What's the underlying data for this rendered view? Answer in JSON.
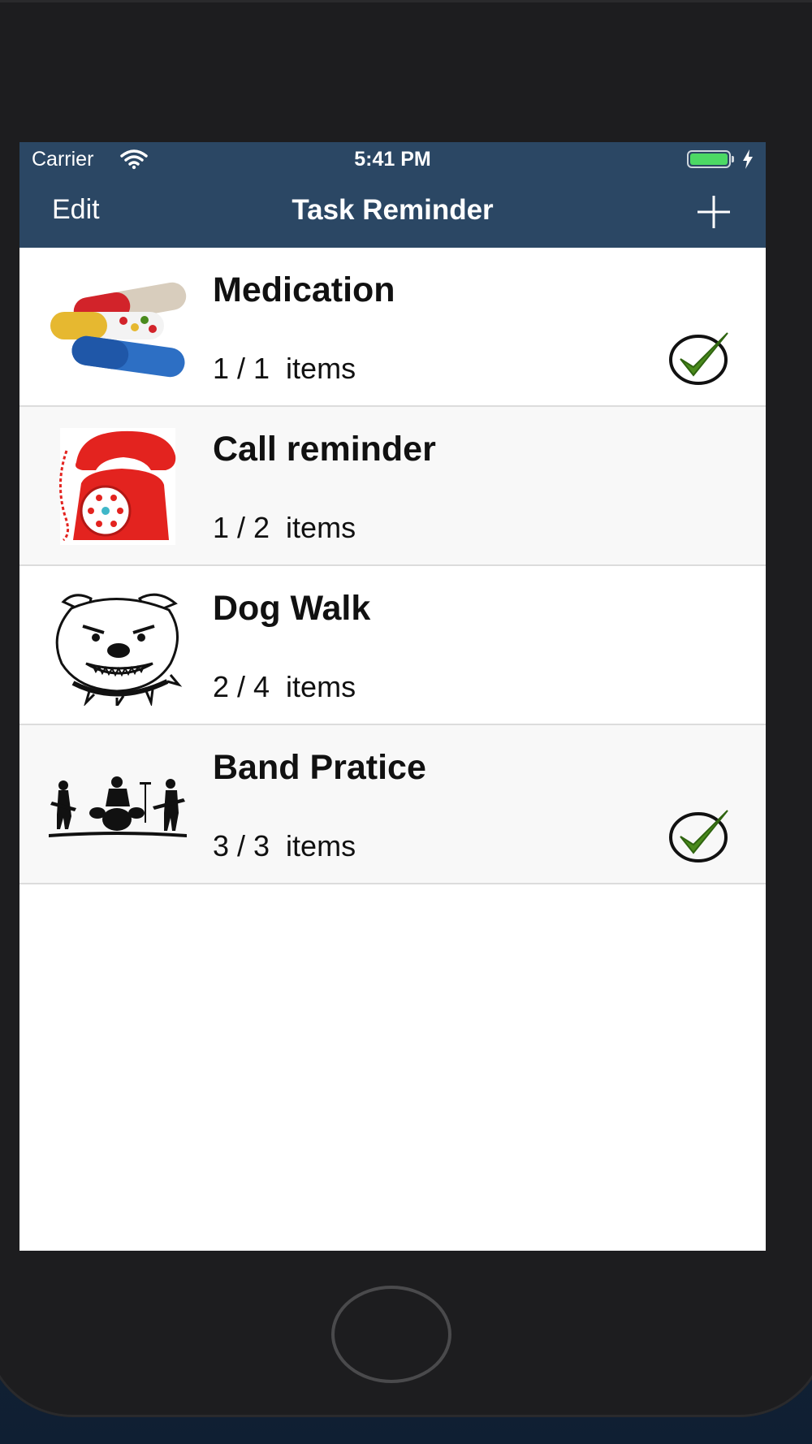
{
  "status_bar": {
    "carrier": "Carrier",
    "time": "5:41 PM",
    "battery_level": 1.0,
    "charging": true
  },
  "nav": {
    "edit_label": "Edit",
    "title": "Task Reminder",
    "add_icon": "plus-icon"
  },
  "colors": {
    "nav_background": "#2b4764",
    "check_green": "#4a8a1c",
    "battery_green": "#4cd964"
  },
  "tasks": [
    {
      "title": "Medication",
      "count": "1 / 1  items",
      "image": "pills-image",
      "completed": true
    },
    {
      "title": "Call reminder",
      "count": "1 / 2  items",
      "image": "red-telephone-image",
      "completed": false
    },
    {
      "title": "Dog Walk",
      "count": "2 / 4  items",
      "image": "bulldog-image",
      "completed": false
    },
    {
      "title": "Band Pratice",
      "count": "3 / 3  items",
      "image": "band-silhouette-image",
      "completed": true
    }
  ]
}
